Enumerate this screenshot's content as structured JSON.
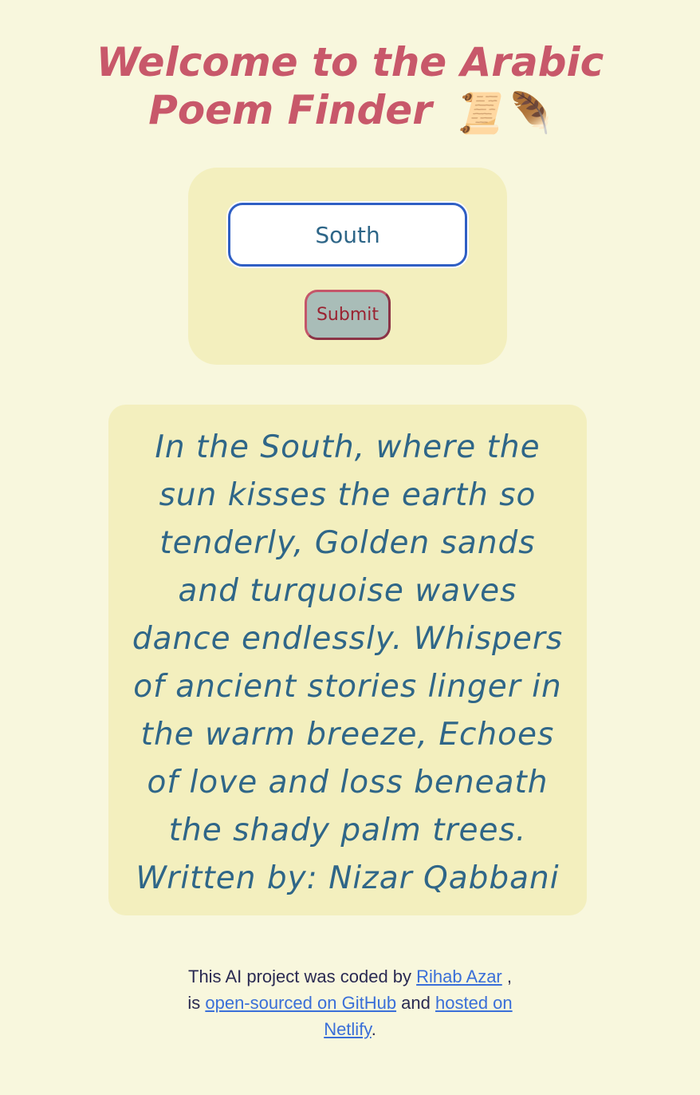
{
  "header": {
    "title": "Welcome to the Arabic Poem Finder",
    "emoji": "📜🪶"
  },
  "search": {
    "value": "South",
    "submit_label": "Submit"
  },
  "poem": {
    "text": "In the South, where the sun kisses the earth so tenderly, Golden sands and turquoise waves dance endlessly. Whispers of ancient stories linger in the warm breeze, Echoes of love and loss beneath the shady palm trees. Written by: Nizar Qabbani"
  },
  "footer": {
    "prefix": "This AI project was coded by ",
    "author_link": "Rihab Azar",
    "middle": " , is ",
    "github_link": "open-sourced on GitHub",
    "and_text": " and ",
    "netlify_link": "hosted on Netlify",
    "suffix": "."
  },
  "colors": {
    "background": "#f8f7dd",
    "card": "#f3efbe",
    "title": "#c8586a",
    "poem_text": "#2f6688",
    "link": "#3a6fd8"
  }
}
